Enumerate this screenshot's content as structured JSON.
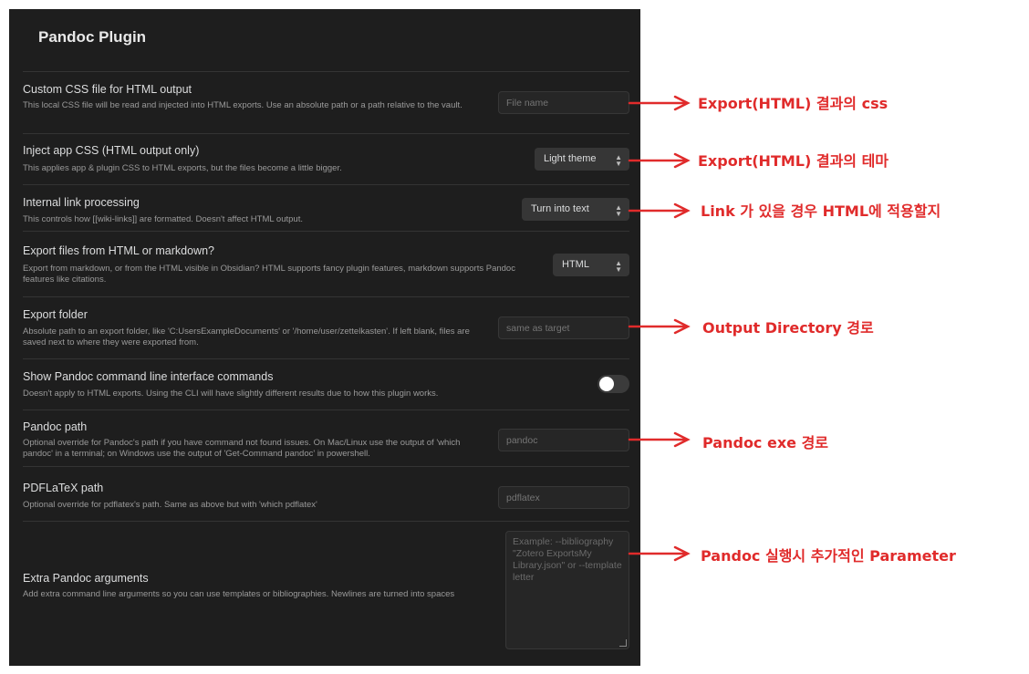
{
  "panel": {
    "title": "Pandoc Plugin"
  },
  "settings": [
    {
      "name": "Custom CSS file for HTML output",
      "desc": "This local CSS file will be read and injected into HTML exports. Use an absolute path or a path relative to the vault.",
      "placeholder": "File name"
    },
    {
      "name": "Inject app CSS (HTML output only)",
      "desc": "This applies app & plugin CSS to HTML exports, but the files become a little bigger.",
      "value": "Light theme"
    },
    {
      "name": "Internal link processing",
      "desc": "This controls how [[wiki-links]] are formatted. Doesn't affect HTML output.",
      "value": "Turn into text"
    },
    {
      "name": "Export files from HTML or markdown?",
      "desc": "Export from markdown, or from the HTML visible in Obsidian? HTML supports fancy plugin features, markdown supports Pandoc features like citations.",
      "value": "HTML"
    },
    {
      "name": "Export folder",
      "desc": "Absolute path to an export folder, like 'C:UsersExampleDocuments' or '/home/user/zettelkasten'. If left blank, files are saved next to where they were exported from.",
      "placeholder": "same as target"
    },
    {
      "name": "Show Pandoc command line interface commands",
      "desc": "Doesn't apply to HTML exports. Using the CLI will have slightly different results due to how this plugin works.",
      "toggle_on": false
    },
    {
      "name": "Pandoc path",
      "desc": "Optional override for Pandoc's path if you have command not found issues. On Mac/Linux use the output of 'which pandoc' in a terminal; on Windows use the output of 'Get-Command pandoc' in powershell.",
      "placeholder": "pandoc"
    },
    {
      "name": "PDFLaTeX path",
      "desc": "Optional override for pdflatex's path. Same as above but with 'which pdflatex'",
      "placeholder": "pdflatex"
    },
    {
      "name": "Extra Pandoc arguments",
      "desc": "Add extra command line arguments so you can use templates or bibliographies. Newlines are turned into spaces",
      "placeholder": "Example: --bibliography \"Zotero ExportsMy Library.json\" or --template letter"
    }
  ],
  "annotations": [
    "Export(HTML) 결과의 css",
    "Export(HTML) 결과의 테마",
    "Link 가 있을 경우 HTML에 적용할지",
    "Output Directory 경로",
    "Pandoc exe 경로",
    "Pandoc 실행시 추가적인 Parameter"
  ],
  "colors": {
    "panel_bg": "#1e1e1e",
    "annotation": "#e02b2b",
    "toggle_knob": "#ffffff"
  }
}
